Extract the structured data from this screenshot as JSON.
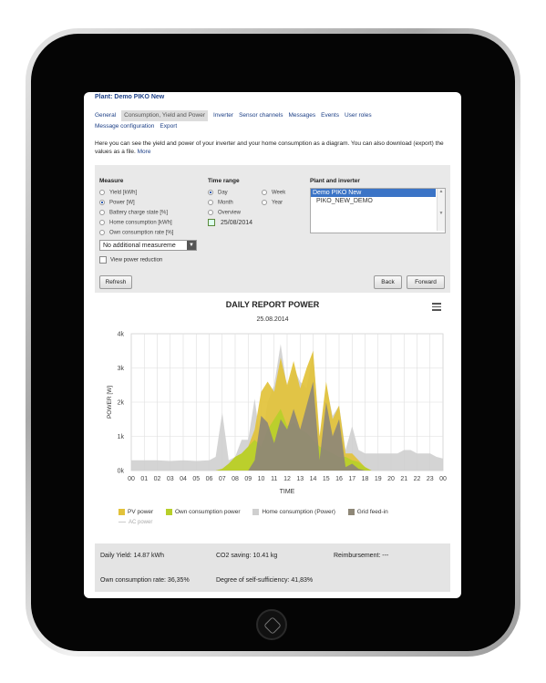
{
  "plant_title": "Plant: Demo PIKO New",
  "tabs": [
    "General",
    "Consumption, Yield and Power",
    "Inverter",
    "Sensor channels",
    "Messages",
    "Events",
    "User roles",
    "Message configuration",
    "Export"
  ],
  "active_tab": 1,
  "intro": {
    "text": "Here you can see the yield and power of your inverter and your home consumption as a diagram. You can also download (export) the values as a file.",
    "more": "More"
  },
  "measure": {
    "title": "Measure",
    "options": [
      "Yield [kWh]",
      "Power [W]",
      "Battery charge state [%]",
      "Home consumption [kWh]",
      "Own consumption rate [%]"
    ],
    "selected": 1,
    "additional": "No additional measureme",
    "view_power_reduction": "View power reduction"
  },
  "time_range": {
    "title": "Time range",
    "options": [
      "Day",
      "Month",
      "Overview",
      "Week",
      "Year"
    ],
    "selected": 0,
    "date": "25/08/2014"
  },
  "plant_inverter": {
    "title": "Plant and inverter",
    "items": [
      "Demo PIKO New",
      "PIKO_NEW_DEMO"
    ],
    "selected": 0
  },
  "buttons": {
    "refresh": "Refresh",
    "back": "Back",
    "forward": "Forward"
  },
  "colors": {
    "pv": "#e2c23a",
    "own": "#b7cf2a",
    "home": "#cfcfcf",
    "grid": "#8e8777",
    "ac": "#d9d9d9"
  },
  "chart_data": {
    "type": "area",
    "title": "DAILY REPORT POWER",
    "subtitle": "25.08.2014",
    "xlabel": "TIME",
    "ylabel": "POWER [W]",
    "ylim": [
      0,
      4000
    ],
    "y_ticks": [
      "0k",
      "1k",
      "2k",
      "3k",
      "4k"
    ],
    "x_ticks": [
      "00",
      "01",
      "02",
      "03",
      "04",
      "05",
      "06",
      "07",
      "08",
      "09",
      "10",
      "11",
      "12",
      "13",
      "14",
      "15",
      "16",
      "17",
      "18",
      "19",
      "20",
      "21",
      "22",
      "23",
      "00"
    ],
    "x": [
      0,
      1,
      2,
      3,
      4,
      5,
      6,
      6.5,
      7,
      7.5,
      8,
      8.5,
      9,
      9.5,
      10,
      10.5,
      11,
      11.5,
      12,
      12.5,
      13,
      13.5,
      14,
      14.5,
      15,
      15.5,
      16,
      16.5,
      17,
      17.5,
      18,
      18.5,
      19,
      19.5,
      20,
      20.5,
      21,
      21.5,
      22,
      22.5,
      23,
      23.5,
      24
    ],
    "series": [
      {
        "name": "Home consumption (Power)",
        "values": [
          300,
          300,
          300,
          280,
          300,
          280,
          300,
          400,
          1700,
          300,
          400,
          900,
          900,
          2100,
          700,
          2000,
          2500,
          3700,
          2400,
          3000,
          2600,
          2400,
          3500,
          900,
          2500,
          1600,
          1900,
          600,
          1300,
          600,
          500,
          500,
          500,
          500,
          500,
          500,
          600,
          600,
          500,
          500,
          500,
          400,
          350
        ]
      },
      {
        "name": "PV power",
        "values": [
          0,
          0,
          0,
          0,
          0,
          0,
          0,
          0,
          50,
          200,
          400,
          500,
          700,
          1200,
          2300,
          2600,
          2300,
          3300,
          2500,
          3200,
          2400,
          3000,
          3500,
          1000,
          2600,
          1500,
          1900,
          500,
          500,
          300,
          100,
          0,
          0,
          0,
          0,
          0,
          0,
          0,
          0,
          0,
          0,
          0,
          0
        ]
      },
      {
        "name": "Own consumption power",
        "values": [
          0,
          0,
          0,
          0,
          0,
          0,
          0,
          0,
          50,
          200,
          400,
          500,
          700,
          900,
          700,
          1200,
          1500,
          1800,
          1300,
          1400,
          1200,
          1100,
          900,
          700,
          600,
          500,
          400,
          400,
          300,
          250,
          100,
          0,
          0,
          0,
          0,
          0,
          0,
          0,
          0,
          0,
          0,
          0,
          0
        ]
      },
      {
        "name": "Grid feed-in",
        "values": [
          0,
          0,
          0,
          0,
          0,
          0,
          0,
          0,
          0,
          0,
          0,
          0,
          0,
          300,
          1600,
          1400,
          800,
          1500,
          1200,
          1800,
          1200,
          1900,
          2600,
          300,
          2000,
          1000,
          1500,
          100,
          200,
          50,
          0,
          0,
          0,
          0,
          0,
          0,
          0,
          0,
          0,
          0,
          0,
          0,
          0
        ]
      }
    ],
    "extra_legend": "AC power",
    "grid": true,
    "legend_position": "bottom"
  },
  "summary": {
    "daily_yield": "Daily Yield: 14.87 kWh",
    "co2": "CO2 saving: 10.41 kg",
    "reimbursement": "Reimbursement: ---",
    "own_rate": "Own consumption rate: 36,35%",
    "self_sufficiency": "Degree of self-sufficiency: 41,83%"
  }
}
